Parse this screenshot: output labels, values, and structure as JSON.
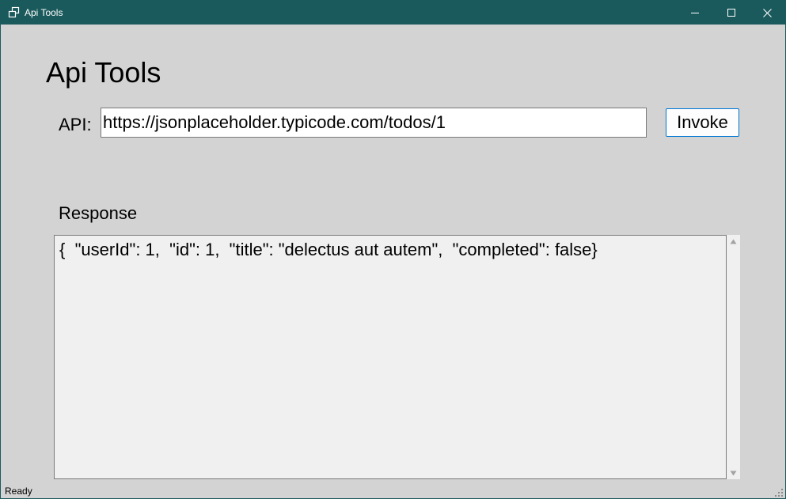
{
  "window": {
    "title": "Api Tools",
    "icons": {
      "app": "app-window-icon",
      "minimize": "minimize-icon",
      "maximize": "maximize-icon",
      "close": "close-icon"
    }
  },
  "main": {
    "heading": "Api Tools",
    "api_label": "API:",
    "api_value": "https://jsonplaceholder.typicode.com/todos/1",
    "invoke_label": "Invoke",
    "response_label": "Response",
    "response_text": "{  \"userId\": 1,  \"id\": 1,  \"title\": \"delectus aut autem\",  \"completed\": false}"
  },
  "status": {
    "text": "Ready"
  },
  "colors": {
    "titlebar": "#1b5a5c",
    "background": "#d3d3d3",
    "accent": "#0078d4"
  }
}
